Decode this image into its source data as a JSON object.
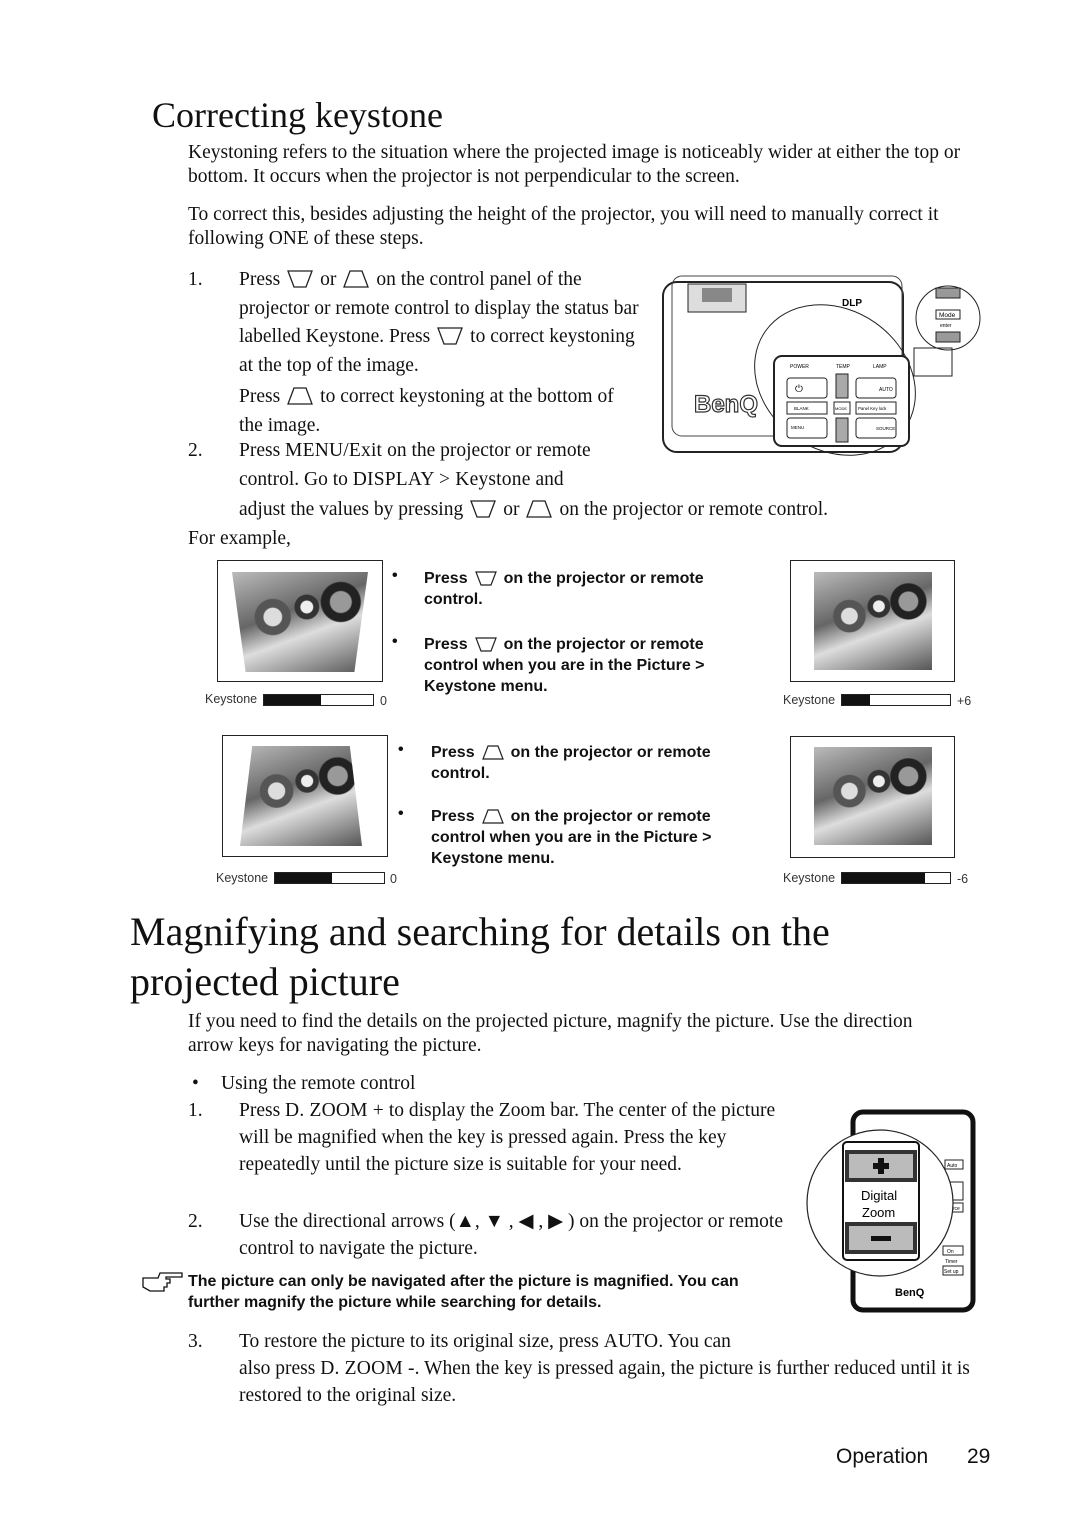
{
  "section1": {
    "title": "Correcting keystone",
    "para1": "Keystoning refers to the situation where the projected image is noticeably wider at either the top or bottom. It occurs when the projector is not perpendicular to the screen.",
    "para2": "To correct this, besides adjusting the height of the projector, you will need to manually correct it following ONE of these steps.",
    "step1": {
      "num": "1.",
      "a": "Press",
      "b": "or",
      "c": "on the control panel of the projector or remote control to display the status bar labelled Keystone. Press",
      "d": "to correct keystoning at the top of the image.",
      "e": "Press",
      "f": "to correct keystoning at the bottom of the image."
    },
    "step2": {
      "num": "2.",
      "a": "Press ",
      "menu": "MENU/Exit",
      "b": " on the projector or remote control. Go to ",
      "path": "DISPLAY > Keystone",
      "c": " and",
      "d": "adjust the values by pressing",
      "e": "or",
      "f": "on the projector or remote control."
    },
    "for_example": "For example,",
    "examples": [
      {
        "label": "Keystone",
        "value": "0",
        "fill_percent": 52,
        "shape": "wide-top"
      },
      {
        "label": "Keystone",
        "value": "+6",
        "fill_percent": 26,
        "shape": "square"
      },
      {
        "label": "Keystone",
        "value": "0",
        "fill_percent": 52,
        "shape": "wide-bottom"
      },
      {
        "label": "Keystone",
        "value": "-6",
        "fill_percent": 77,
        "shape": "square"
      }
    ],
    "bullets_top": [
      {
        "a": "Press",
        "b": "on the projector or remote control."
      },
      {
        "a": "Press",
        "b": "on the projector or remote control when you are in the Picture > Keystone menu."
      }
    ],
    "bullets_bottom": [
      {
        "a": "Press",
        "b": "on the projector or remote control."
      },
      {
        "a": "Press",
        "b": "on the projector or remote control when you are in the Picture > Keystone menu."
      }
    ],
    "projector_illustration": {
      "brand": "BenQ",
      "buttons": [
        "POWER",
        "TEMP",
        "LAMP",
        "AUTO",
        "BLANK",
        "MODE",
        "Panel Key lock",
        "MENU",
        "SOURCE",
        "Mode",
        "enter"
      ]
    }
  },
  "section2": {
    "title_line1": "Magnifying and searching for details on the",
    "title_line2": "projected picture",
    "para": "If you need to find the details on the projected picture, magnify the picture. Use the direction arrow keys for navigating the picture.",
    "bullet": "Using the remote control",
    "step1": {
      "num": "1.",
      "a": "Press ",
      "key": "D. ZOOM +",
      "b": " to display the Zoom bar. The center of the picture will be magnified when the key is pressed again. Press the key repeatedly until the picture size is suitable for your need."
    },
    "step2": {
      "num": "2.",
      "text": "Use the directional arrows (▲, ▼ , ◀ , ▶ ) on the projector or remote control to navigate the picture."
    },
    "note": "The picture can only be navigated after the picture is magnified. You can further magnify the picture while searching for details.",
    "step3": {
      "num": "3.",
      "a": "To restore the picture to its original size, press ",
      "auto": "AUTO",
      "b": ". You can",
      "c": "also press ",
      "key": "D. ZOOM -",
      "d": ". When the key is pressed again, the picture is further reduced until it is restored to the original size."
    },
    "remote_illustration": {
      "label_line1": "Digital",
      "label_line2": "Zoom",
      "brand": "BenQ",
      "buttons": [
        "Auto",
        "Source",
        "On",
        "Timer",
        "Set up"
      ]
    }
  },
  "footer": {
    "section": "Operation",
    "page": "29"
  }
}
